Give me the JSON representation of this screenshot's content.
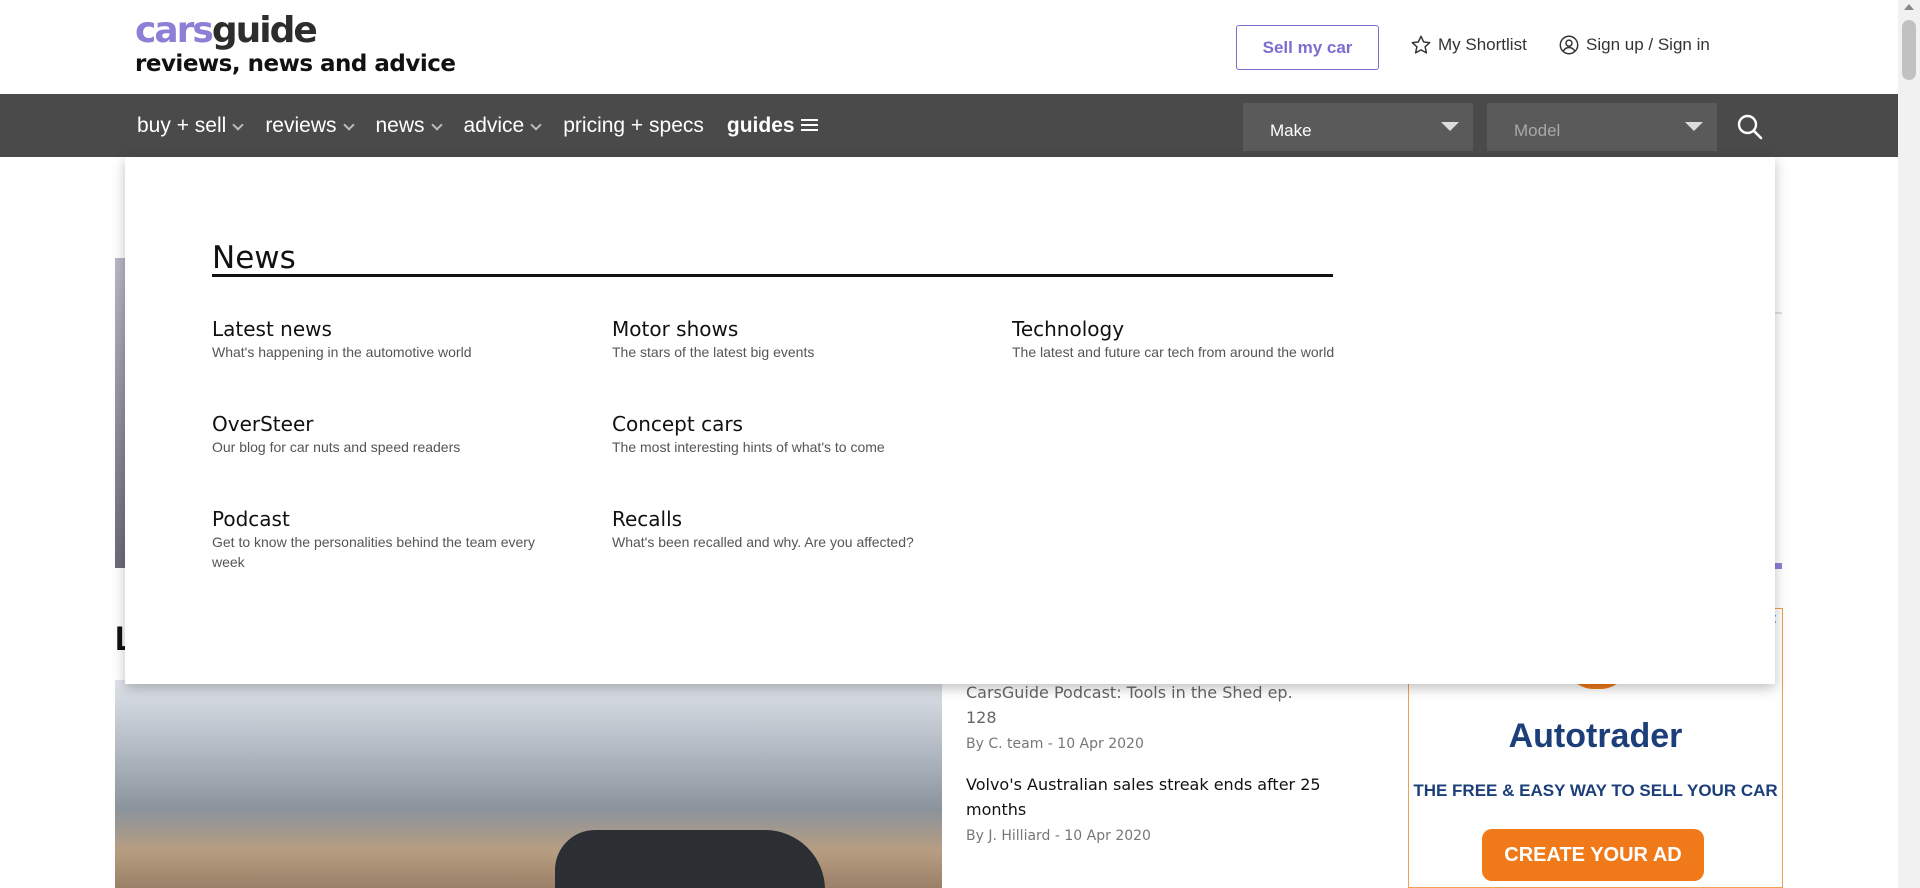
{
  "header": {
    "logo_cars": "cars",
    "logo_guide": "guide",
    "logo_tagline": "reviews, news and advice",
    "sell_button": "Sell my car",
    "shortlist": "My Shortlist",
    "signin": "Sign up / Sign in"
  },
  "nav": {
    "items": [
      {
        "label": "buy + sell",
        "dropdown": true
      },
      {
        "label": "reviews",
        "dropdown": true
      },
      {
        "label": "news",
        "dropdown": true
      },
      {
        "label": "advice",
        "dropdown": true
      },
      {
        "label": "pricing + specs",
        "dropdown": false
      },
      {
        "label": "guides",
        "dropdown": false
      }
    ],
    "make_select": "Make",
    "model_select": "Model"
  },
  "mega_menu": {
    "title": "News",
    "items": [
      {
        "label": "Latest news",
        "desc": "What's happening in the automotive world"
      },
      {
        "label": "Motor shows",
        "desc": "The stars of the latest big events"
      },
      {
        "label": "Technology",
        "desc": "The latest and future car tech from around the world"
      },
      {
        "label": "OverSteer",
        "desc": "Our blog for car nuts and speed readers"
      },
      {
        "label": "Concept cars",
        "desc": "The most interesting hints of what's to come"
      },
      {
        "label": "Podcast",
        "desc": "Get to know the personalities behind the team every week"
      },
      {
        "label": "Recalls",
        "desc": "What's been recalled and why. Are you affected?"
      }
    ]
  },
  "background": {
    "section_letter": "L",
    "articles": [
      {
        "title": "CarsGuide Podcast: Tools in the Shed ep. 128",
        "meta": "By C. team - 10 Apr 2020"
      },
      {
        "title": "Volvo's Australian sales streak ends after 25 months",
        "meta": "By J. Hilliard - 10 Apr 2020"
      }
    ],
    "ad": {
      "brand": "Autotrader",
      "tagline": "THE FREE & EASY WAY TO SELL YOUR CAR",
      "cta": "CREATE YOUR AD",
      "close": "✕"
    }
  },
  "colors": {
    "brand_purple": "#8c7fd6",
    "nav_bg": "#4a4a4a",
    "ad_orange": "#f07a1a",
    "ad_blue": "#1c3f7a"
  }
}
